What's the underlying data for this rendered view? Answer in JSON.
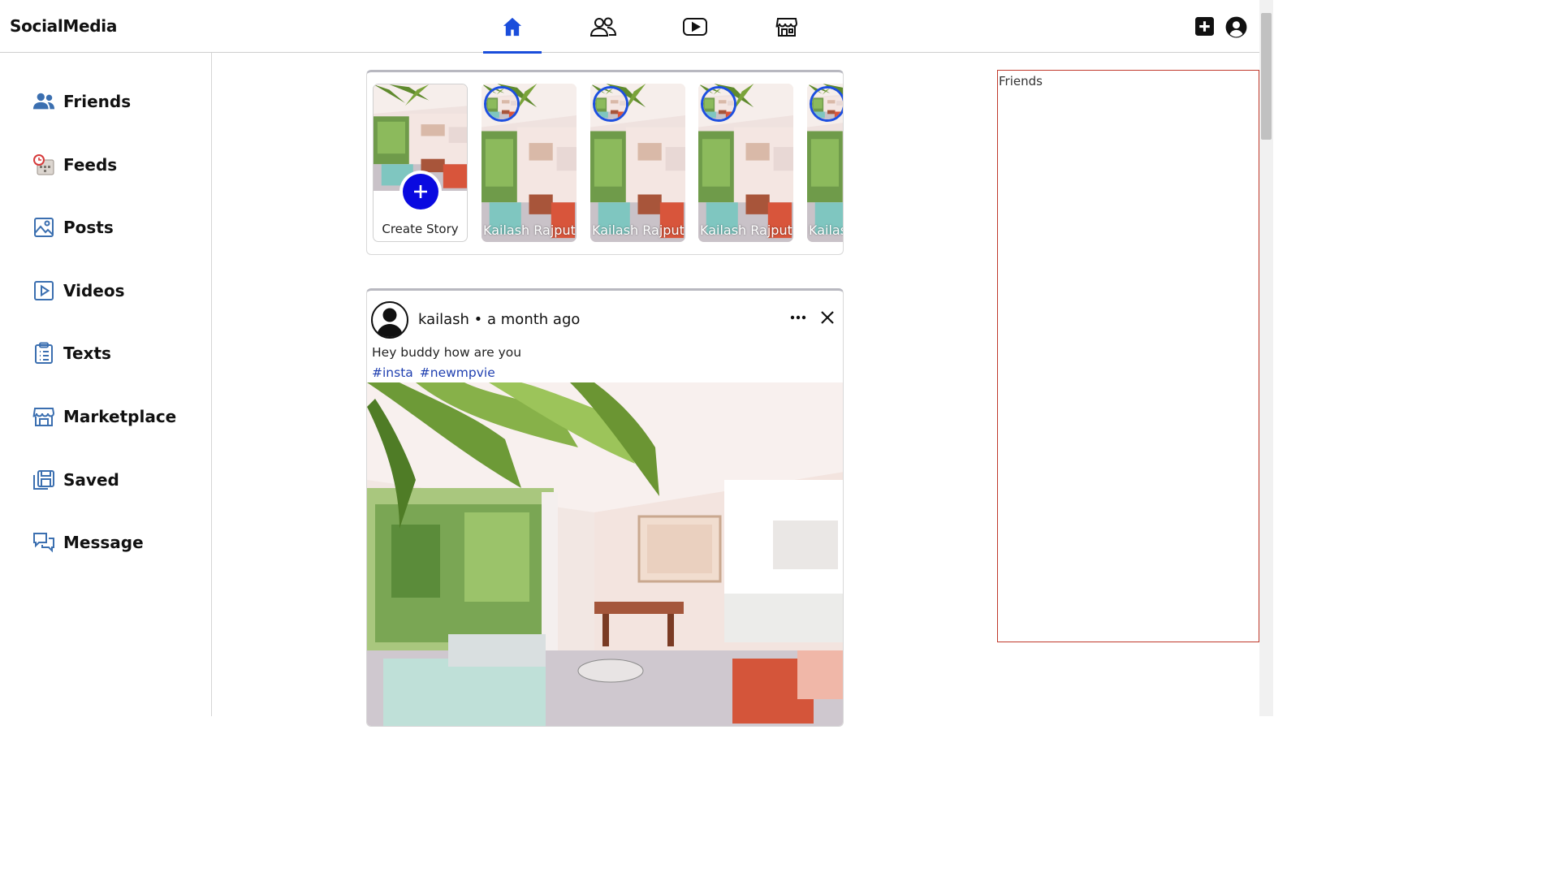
{
  "app": {
    "brand": "SocialMedia"
  },
  "nav": {
    "tabs": [
      {
        "icon": "home-icon",
        "active": true
      },
      {
        "icon": "friends-icon",
        "active": false
      },
      {
        "icon": "video-icon",
        "active": false
      },
      {
        "icon": "marketplace-icon",
        "active": false
      }
    ],
    "right": [
      {
        "icon": "add-square-icon"
      },
      {
        "icon": "user-circle-icon"
      }
    ],
    "accent": "#1a4ddb"
  },
  "sidebar": {
    "items": [
      {
        "label": "Friends",
        "icon": "people-icon"
      },
      {
        "label": "Feeds",
        "icon": "feeds-calendar-icon"
      },
      {
        "label": "Posts",
        "icon": "image-icon"
      },
      {
        "label": "Videos",
        "icon": "play-square-icon"
      },
      {
        "label": "Texts",
        "icon": "clipboard-list-icon"
      },
      {
        "label": "Marketplace",
        "icon": "store-icon"
      },
      {
        "label": "Saved",
        "icon": "saved-icon"
      },
      {
        "label": "Message",
        "icon": "chat-icon"
      }
    ],
    "icon_color": "#3b6fb0"
  },
  "stories": {
    "create_label": "Create Story",
    "items": [
      {
        "name": "Kailash Rajput"
      },
      {
        "name": "Kailash Rajput"
      },
      {
        "name": "Kailash Rajput"
      },
      {
        "name": "Kailash Rajput"
      }
    ]
  },
  "post": {
    "author_line": "kailash • a month ago",
    "caption": "Hey buddy how are you",
    "tags": [
      "#insta",
      "#newmpvie"
    ]
  },
  "friends_panel": {
    "title": "Friends"
  }
}
